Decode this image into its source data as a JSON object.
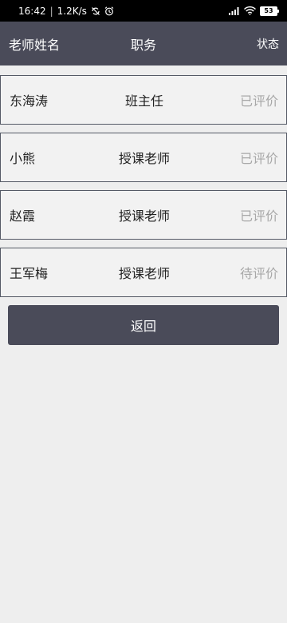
{
  "status_bar": {
    "time": "16:42",
    "speed": "1.2K/s",
    "battery": "53",
    "icons": [
      "sync-off-icon",
      "alarm-icon",
      "signal-icon",
      "wifi-icon",
      "battery-icon"
    ]
  },
  "header": {
    "name_label": "老师姓名",
    "role_label": "职务",
    "status_label": "状态",
    "background": "#4a4b59"
  },
  "teachers": [
    {
      "name": "东海涛",
      "role": "班主任",
      "status": "已评价"
    },
    {
      "name": "小熊",
      "role": "授课老师",
      "status": "已评价"
    },
    {
      "name": "赵霞",
      "role": "授课老师",
      "status": "已评价"
    },
    {
      "name": "王军梅",
      "role": "授课老师",
      "status": "待评价"
    }
  ],
  "back_button": {
    "label": "返回",
    "background": "#4a4b59"
  }
}
